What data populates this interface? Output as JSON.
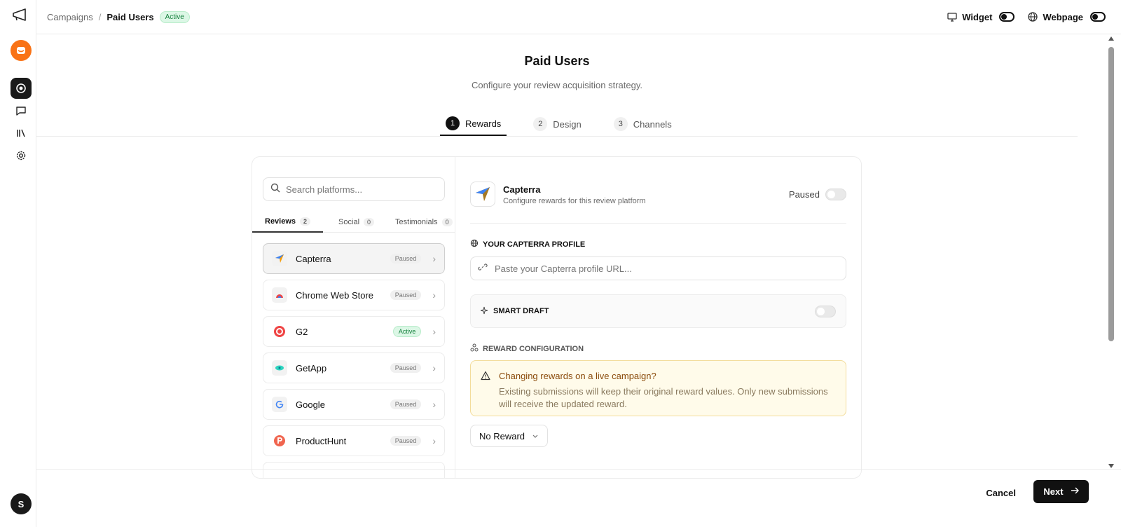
{
  "header": {
    "breadcrumb_root": "Campaigns",
    "breadcrumb_sep": "/",
    "breadcrumb_current": "Paid Users",
    "status_badge": "Active",
    "widget_label": "Widget",
    "webpage_label": "Webpage"
  },
  "sidebar": {
    "avatar_initial": "S",
    "icons": [
      "megaphone-icon",
      "brand-icon",
      "target-icon",
      "message-icon",
      "library-icon",
      "settings-icon"
    ]
  },
  "page": {
    "title": "Paid Users",
    "subtitle": "Configure your review acquisition strategy."
  },
  "steps": [
    {
      "num": "1",
      "label": "Rewards"
    },
    {
      "num": "2",
      "label": "Design"
    },
    {
      "num": "3",
      "label": "Channels"
    }
  ],
  "platforms": {
    "search_placeholder": "Search platforms...",
    "tabs": [
      {
        "label": "Reviews",
        "count": "2"
      },
      {
        "label": "Social",
        "count": "0"
      },
      {
        "label": "Testimonials",
        "count": "0"
      }
    ],
    "items": [
      {
        "name": "Capterra",
        "status": "Paused"
      },
      {
        "name": "Chrome Web Store",
        "status": "Paused"
      },
      {
        "name": "G2",
        "status": "Active"
      },
      {
        "name": "GetApp",
        "status": "Paused"
      },
      {
        "name": "Google",
        "status": "Paused"
      },
      {
        "name": "ProductHunt",
        "status": "Paused"
      }
    ]
  },
  "detail": {
    "name": "Capterra",
    "description": "Configure rewards for this review platform",
    "status": "Paused",
    "profile_label": "YOUR CAPTERRA PROFILE",
    "profile_placeholder": "Paste your Capterra profile URL...",
    "smart_draft_label": "SMART DRAFT",
    "reward_config_label": "REWARD CONFIGURATION",
    "warning_title": "Changing rewards on a live campaign?",
    "warning_body": "Existing submissions will keep their original reward values. Only new submissions will receive the updated reward.",
    "reward_select": "No Reward"
  },
  "footer": {
    "cancel_label": "Cancel",
    "next_label": "Next"
  },
  "colors": {
    "accent": "#111111",
    "brand_orange": "#f97316",
    "active_green": "#15803d",
    "warning_bg": "#fffbea"
  }
}
